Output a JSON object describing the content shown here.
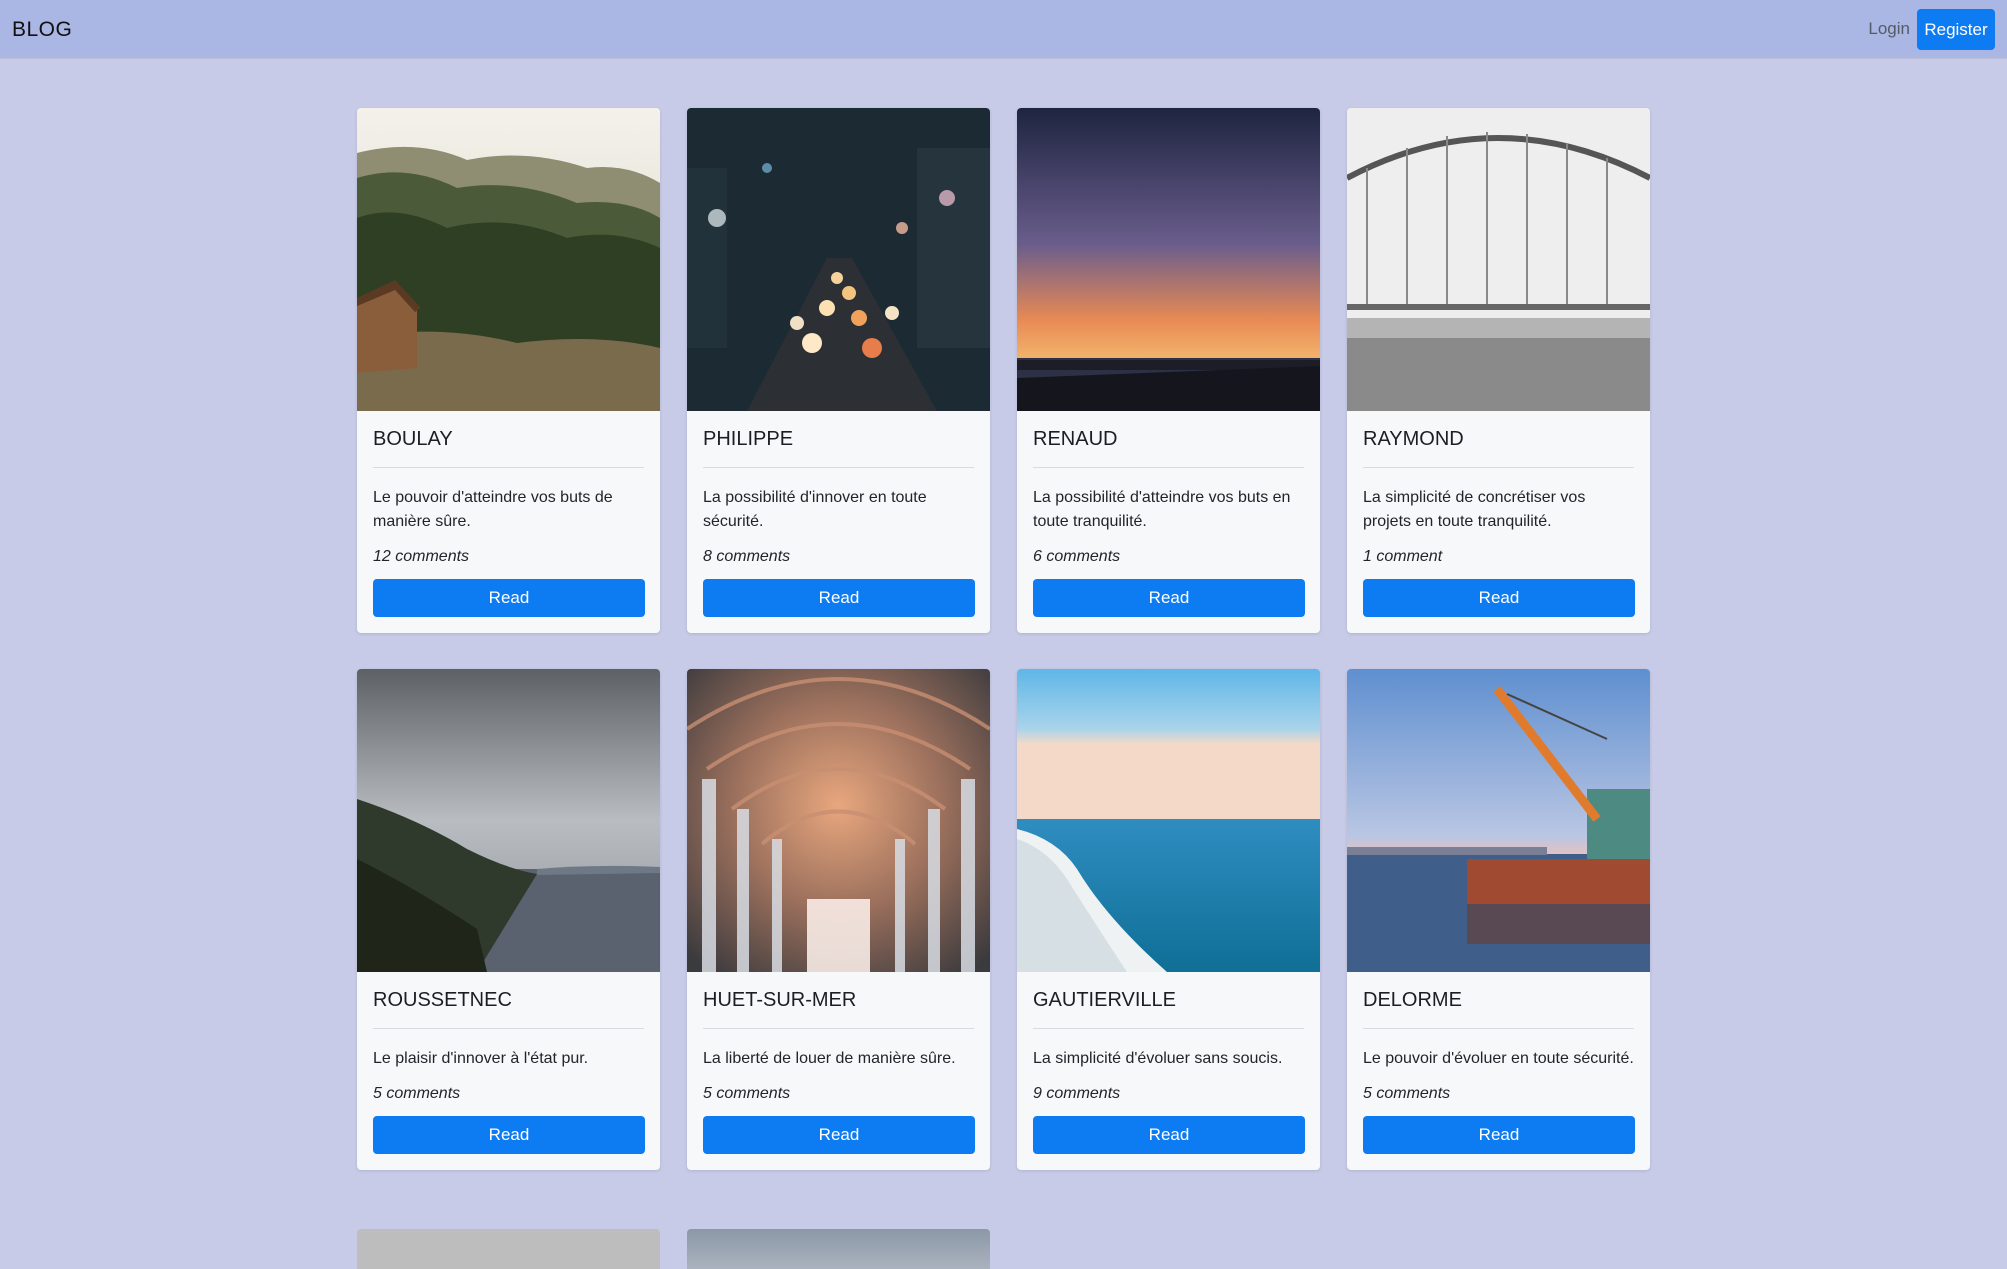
{
  "nav": {
    "brand": "BLOG",
    "login": "Login",
    "register": "Register"
  },
  "colors": {
    "background": "#c7cbe7",
    "navbar": "#aab6e3",
    "primary": "#0d7cf2",
    "card": "#f7f8fa"
  },
  "cards": [
    {
      "title": "BOULAY",
      "text": "Le pouvoir d'atteindre vos buts de manière sûre.",
      "comments": "12 comments",
      "button": "Read",
      "image": "forest-cabin-mountains"
    },
    {
      "title": "PHILIPPE",
      "text": "La possibilité d'innover en toute sécurité.",
      "comments": "8 comments",
      "button": "Read",
      "image": "city-traffic-night-bokeh"
    },
    {
      "title": "RENAUD",
      "text": "La possibilité d'atteindre vos buts en toute tranquilité.",
      "comments": "6 comments",
      "button": "Read",
      "image": "sunset-pier"
    },
    {
      "title": "RAYMOND",
      "text": "La simplicité de concrétiser vos projets en toute tranquilité.",
      "comments": "1 comment",
      "button": "Read",
      "image": "foggy-bridge"
    },
    {
      "title": "ROUSSETNEC",
      "text": "Le plaisir d'innover à l'état pur.",
      "comments": "5 comments",
      "button": "Read",
      "image": "cloudy-coastline"
    },
    {
      "title": "HUET-SUR-MER",
      "text": "La liberté de louer de manière sûre.",
      "comments": "5 comments",
      "button": "Read",
      "image": "cathedral-arches"
    },
    {
      "title": "GAUTIERVILLE",
      "text": "La simplicité d'évoluer sans soucis.",
      "comments": "9 comments",
      "button": "Read",
      "image": "ocean-cliff"
    },
    {
      "title": "DELORME",
      "text": "Le pouvoir d'évoluer en toute sécurité.",
      "comments": "5 comments",
      "button": "Read",
      "image": "harbor-crane-ship"
    }
  ]
}
